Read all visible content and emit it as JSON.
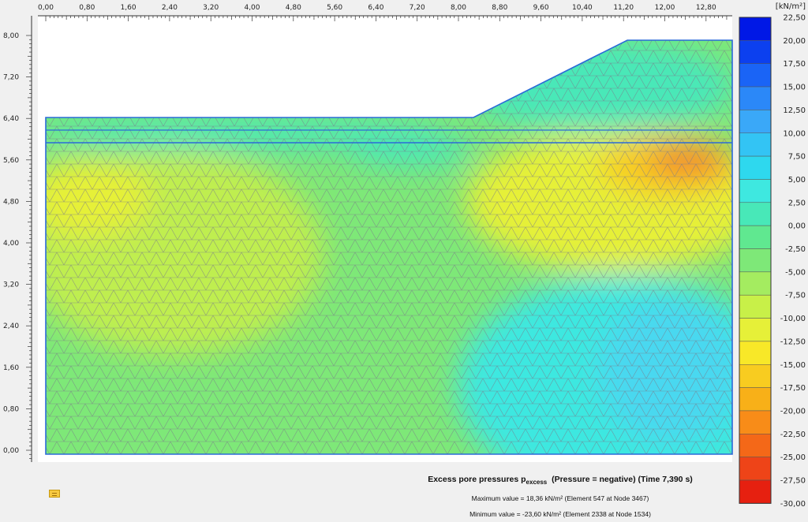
{
  "axes": {
    "x_ticks": [
      "0,00",
      "0,80",
      "1,60",
      "2,40",
      "3,20",
      "4,00",
      "4,80",
      "5,60",
      "6,40",
      "7,20",
      "8,00",
      "8,80",
      "9,60",
      "10,40",
      "11,20",
      "12,00",
      "12,80"
    ],
    "y_ticks": [
      "8,00",
      "7,20",
      "6,40",
      "5,60",
      "4,80",
      "4,00",
      "3,20",
      "2,40",
      "1,60",
      "0,80",
      "0,00"
    ]
  },
  "legend": {
    "unit": "[kN/m²]",
    "labels": [
      "22,50",
      "20,00",
      "17,50",
      "15,00",
      "12,50",
      "10,00",
      "7,50",
      "5,00",
      "2,50",
      "0,00",
      "-2,50",
      "-5,00",
      "-7,50",
      "-10,00",
      "-12,50",
      "-15,00",
      "-17,50",
      "-20,00",
      "-22,50",
      "-25,00",
      "-27,50",
      "-30,00"
    ],
    "colors": [
      "#0018e6",
      "#0c40ef",
      "#1a64f6",
      "#2b88f8",
      "#3aa8f8",
      "#33c4f4",
      "#2ed8ee",
      "#3ee8e0",
      "#48e8b8",
      "#60e890",
      "#7ee878",
      "#a4ec60",
      "#c8f048",
      "#e6f038",
      "#f8e828",
      "#f8cc20",
      "#f8b018",
      "#f88c18",
      "#f46818",
      "#ee4418",
      "#e62010"
    ]
  },
  "caption": {
    "title_main": "Excess pore pressures p",
    "title_sub": "excess",
    "title_rest": "(Pressure = negative) (Time 7,390 s)",
    "max_line": "Maximum value = 18,36 kN/m² (Element 547 at Node 3467)",
    "min_line": "Minimum value = -23,60 kN/m² (Element 2338 at Node 1534)"
  },
  "toolbar": {
    "icon": "selection-icon"
  }
}
